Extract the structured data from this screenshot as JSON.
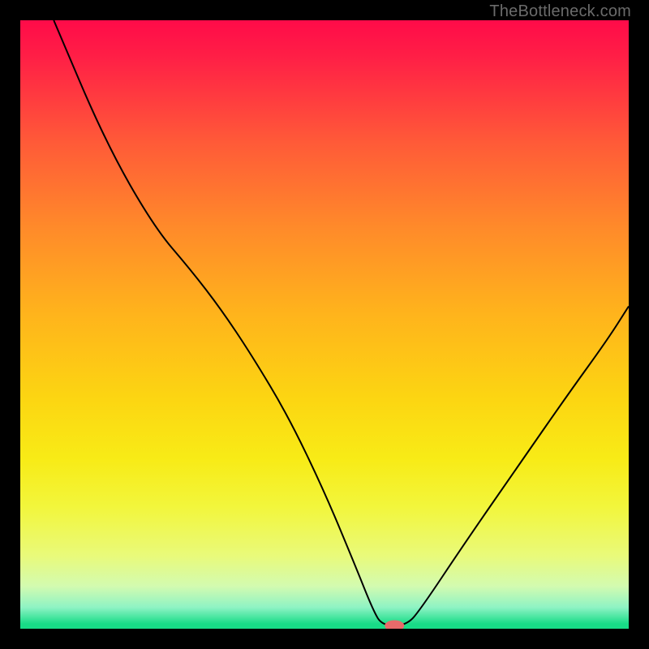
{
  "watermark": "TheBottleneck.com",
  "chart_data": {
    "type": "line",
    "title": "",
    "xlabel": "",
    "ylabel": "",
    "xlim": [
      0,
      100
    ],
    "ylim": [
      0,
      100
    ],
    "grid": false,
    "legend": false,
    "marker": {
      "x": 61.5,
      "y": 0.5,
      "color": "#e86a6a",
      "rx": 1.6,
      "ry": 0.9
    },
    "series": [
      {
        "name": "bottleneck-curve",
        "color": "#000000",
        "points": [
          {
            "x": 5.5,
            "y": 100.0
          },
          {
            "x": 14.0,
            "y": 80.0
          },
          {
            "x": 22.0,
            "y": 66.0
          },
          {
            "x": 28.0,
            "y": 59.0
          },
          {
            "x": 33.0,
            "y": 52.5
          },
          {
            "x": 38.0,
            "y": 45.0
          },
          {
            "x": 44.0,
            "y": 35.0
          },
          {
            "x": 50.0,
            "y": 22.5
          },
          {
            "x": 55.0,
            "y": 10.5
          },
          {
            "x": 58.0,
            "y": 3.0
          },
          {
            "x": 59.5,
            "y": 0.5
          },
          {
            "x": 63.5,
            "y": 0.5
          },
          {
            "x": 66.0,
            "y": 3.5
          },
          {
            "x": 73.0,
            "y": 14.0
          },
          {
            "x": 82.0,
            "y": 27.0
          },
          {
            "x": 90.0,
            "y": 38.5
          },
          {
            "x": 96.5,
            "y": 47.5
          },
          {
            "x": 100.0,
            "y": 53.0
          }
        ]
      }
    ]
  }
}
